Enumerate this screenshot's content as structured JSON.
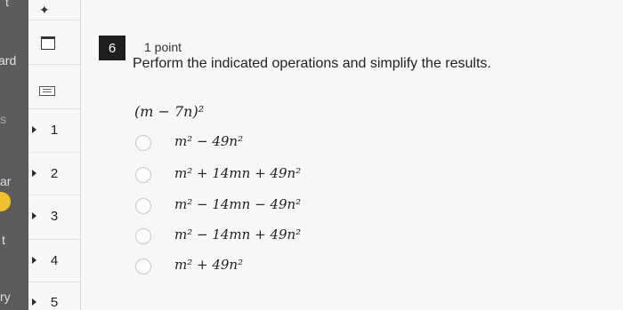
{
  "left_nav": {
    "fragments": [
      "t",
      "ard",
      "s",
      "ar",
      "t",
      "ry"
    ]
  },
  "question_nav": {
    "items": [
      {
        "label": "1"
      },
      {
        "label": "2"
      },
      {
        "label": "3"
      },
      {
        "label": "4"
      },
      {
        "label": "5"
      }
    ]
  },
  "question": {
    "number": "6",
    "points": "1 point",
    "prompt": "Perform the indicated operations and simplify the results.",
    "expression": "(m − 7n)²",
    "choices": [
      {
        "text": "m² − 49n²"
      },
      {
        "text": "m² + 14mn + 49n²"
      },
      {
        "text": "m² − 14mn − 49n²"
      },
      {
        "text": "m² − 14mn + 49n²"
      },
      {
        "text": "m² + 49n²"
      }
    ]
  }
}
